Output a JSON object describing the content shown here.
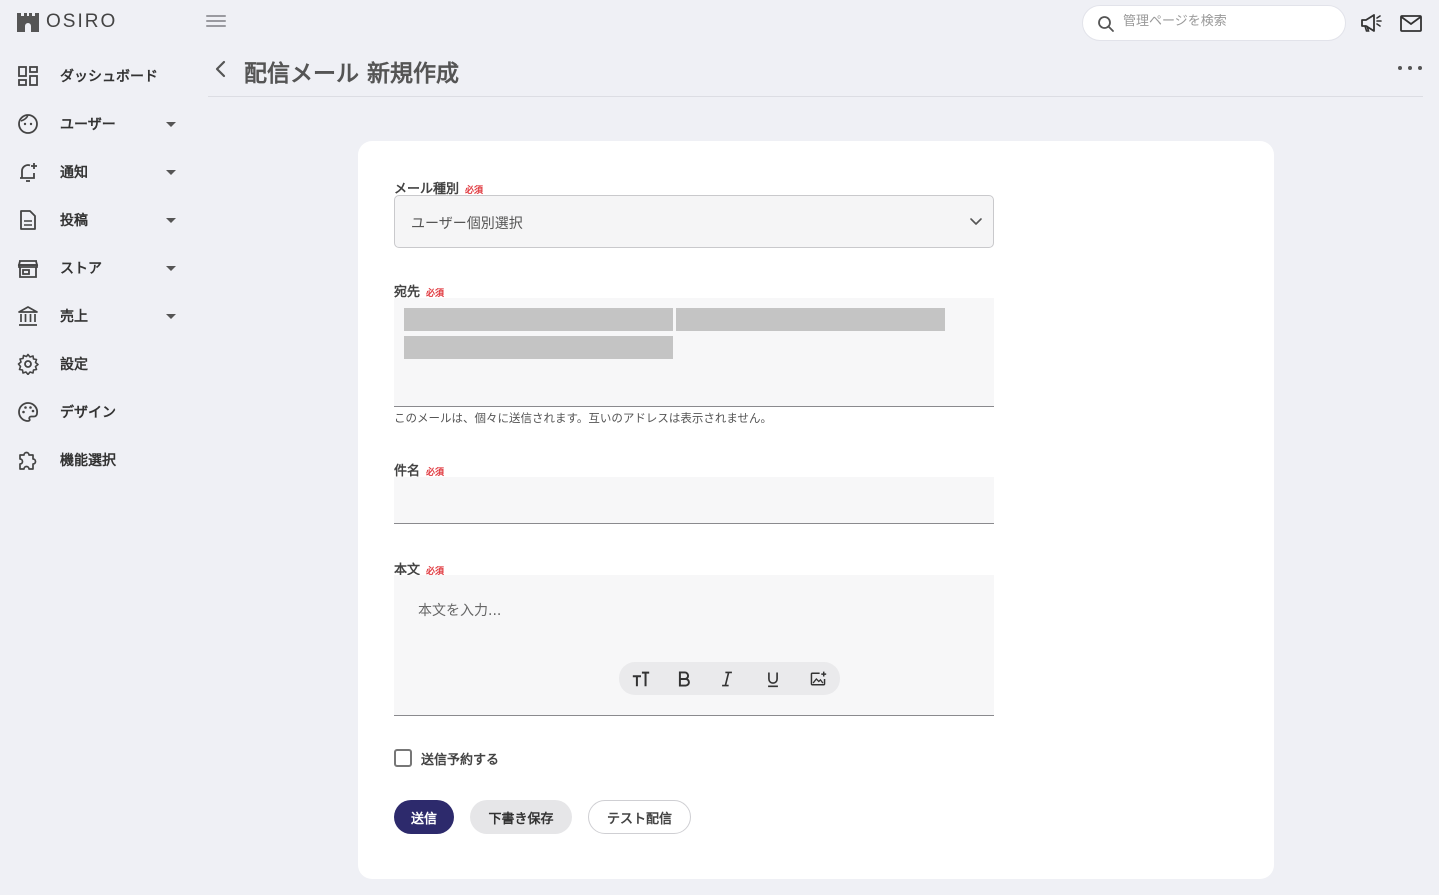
{
  "app": {
    "logo_text": "OSIRO"
  },
  "header": {
    "search_placeholder": "管理ページを検索",
    "announce_icon": "megaphone-icon",
    "mail_icon": "mail-icon"
  },
  "sidebar": {
    "items": [
      {
        "label": "ダッシュボード",
        "icon": "dashboard-icon",
        "has_children": false
      },
      {
        "label": "ユーザー",
        "icon": "user-face-icon",
        "has_children": true
      },
      {
        "label": "通知",
        "icon": "notification-bell-icon",
        "has_children": true
      },
      {
        "label": "投稿",
        "icon": "document-icon",
        "has_children": true
      },
      {
        "label": "ストア",
        "icon": "store-icon",
        "has_children": true
      },
      {
        "label": "売上",
        "icon": "bank-icon",
        "has_children": true
      },
      {
        "label": "設定",
        "icon": "gear-icon",
        "has_children": false
      },
      {
        "label": "デザイン",
        "icon": "palette-icon",
        "has_children": false
      },
      {
        "label": "機能選択",
        "icon": "puzzle-icon",
        "has_children": false
      }
    ]
  },
  "page": {
    "title": "配信メール 新規作成"
  },
  "form": {
    "required_badge": "必須",
    "mail_type": {
      "label": "メール種別",
      "value": "ユーザー個別選択"
    },
    "recipients": {
      "label": "宛先",
      "helper": "このメールは、個々に送信されます。互いのアドレスは表示されません。"
    },
    "subject": {
      "label": "件名",
      "value": ""
    },
    "body": {
      "label": "本文",
      "placeholder": "本文を入力..."
    },
    "schedule": {
      "label": "送信予約する",
      "checked": false
    },
    "buttons": {
      "send": "送信",
      "save_draft": "下書き保存",
      "test_send": "テスト配信"
    }
  }
}
